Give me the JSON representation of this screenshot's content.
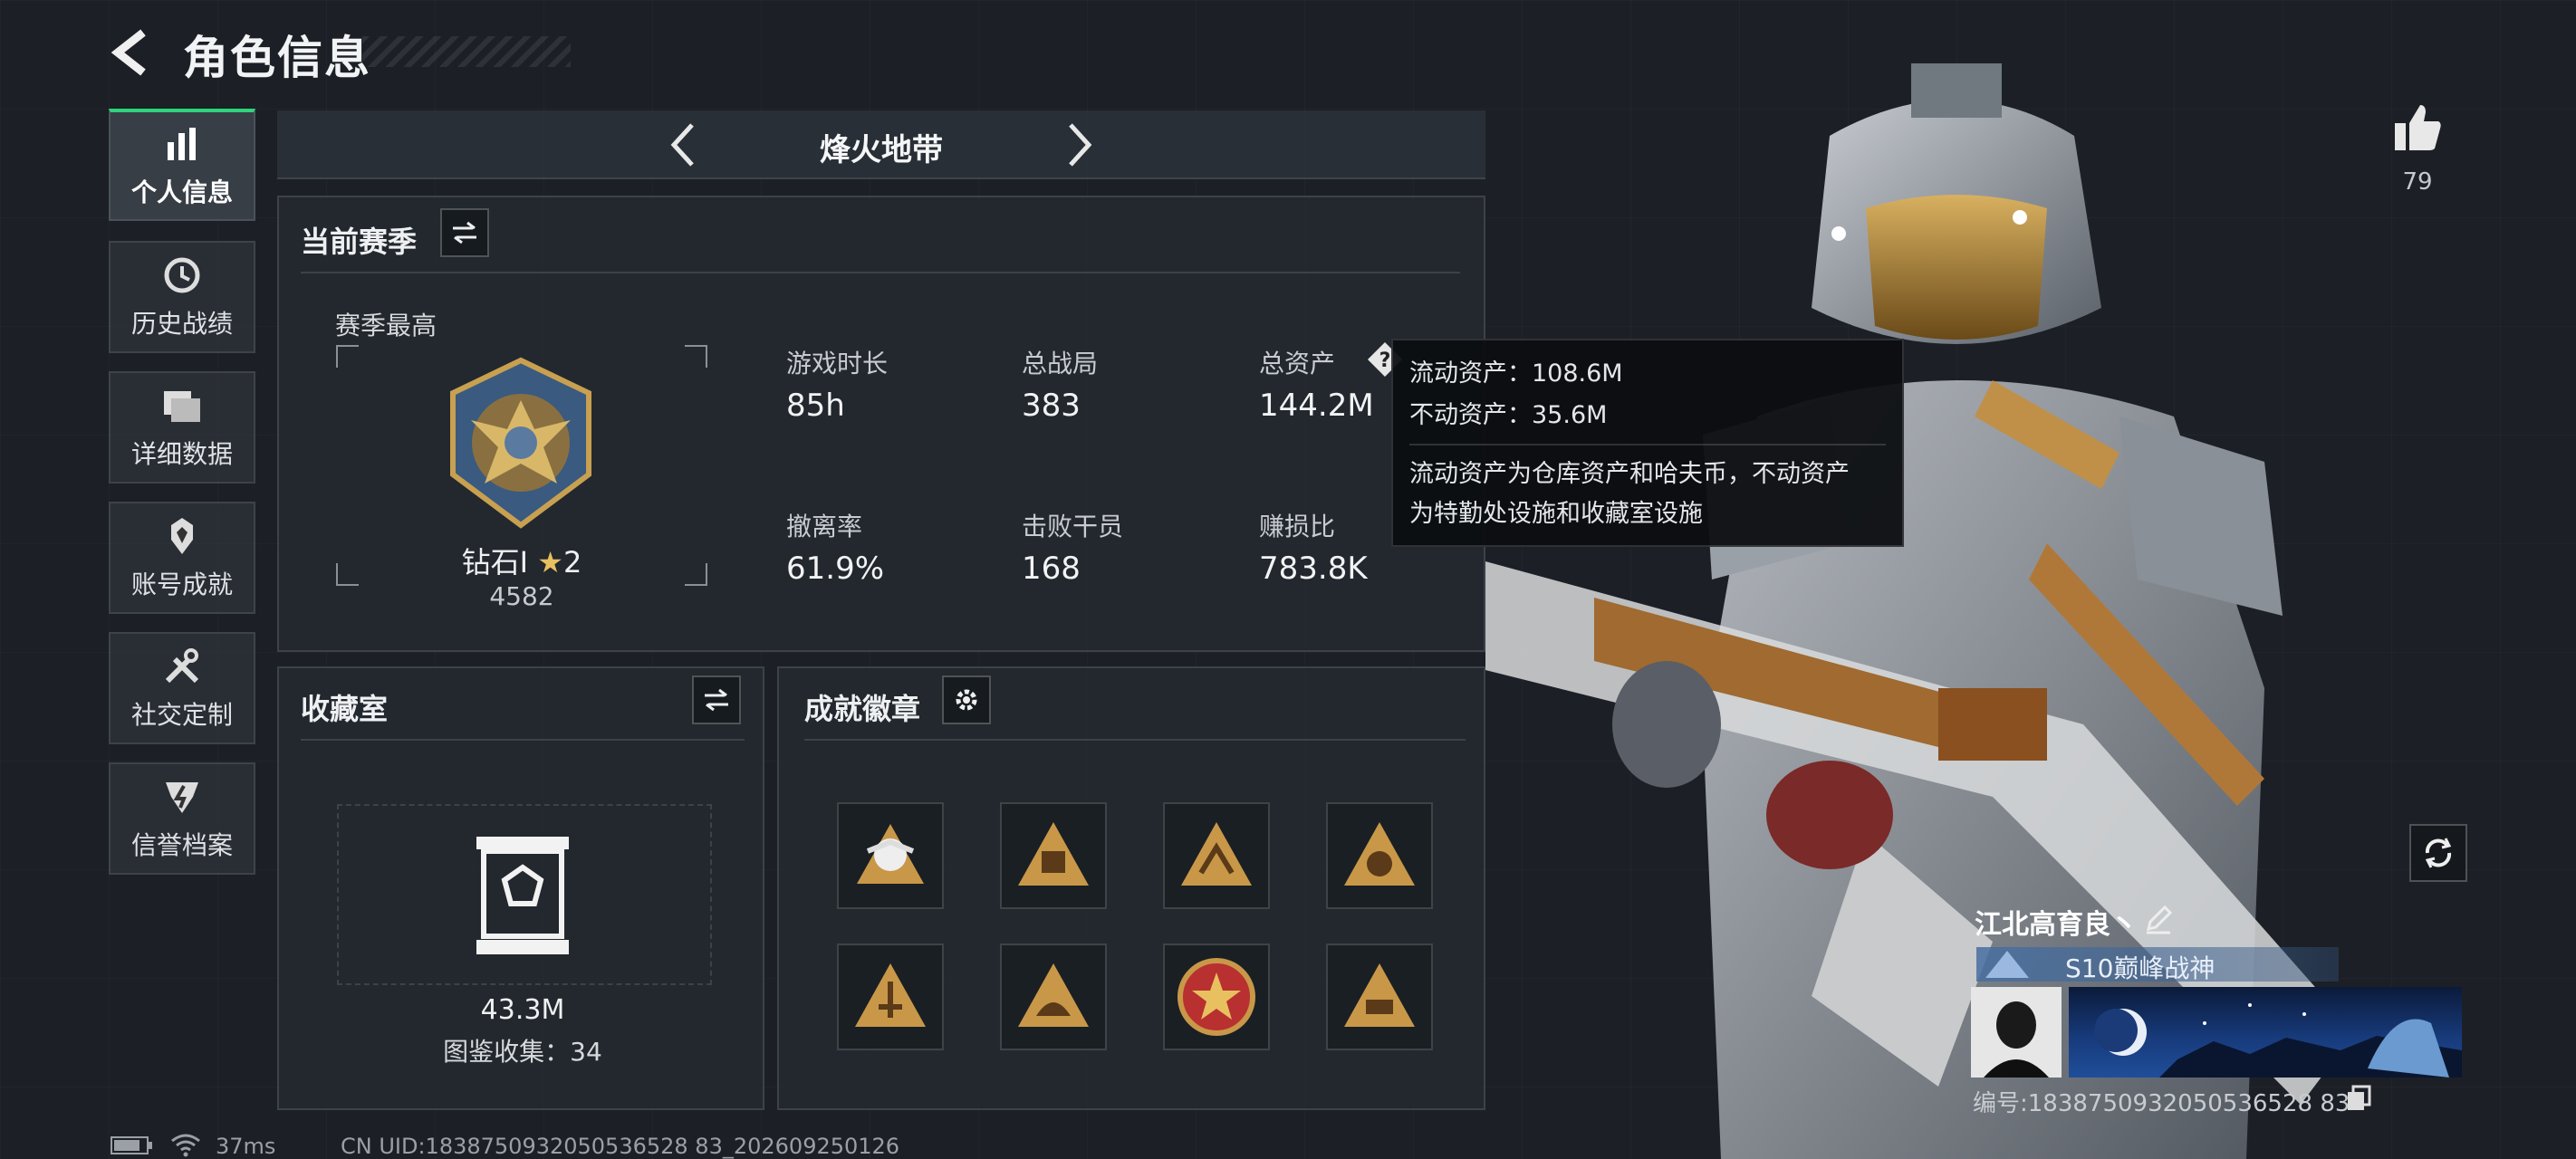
{
  "header": {
    "title": "角色信息"
  },
  "sidebar": {
    "items": [
      {
        "label": "个人信息",
        "icon": "bar-chart-icon",
        "active": true
      },
      {
        "label": "历史战绩",
        "icon": "history-clock-icon",
        "active": false
      },
      {
        "label": "详细数据",
        "icon": "folder-icon",
        "active": false
      },
      {
        "label": "账号成就",
        "icon": "achievement-icon",
        "active": false
      },
      {
        "label": "社交定制",
        "icon": "tools-icon",
        "active": false
      },
      {
        "label": "信誉档案",
        "icon": "reputation-shield-icon",
        "active": false
      }
    ]
  },
  "mode": {
    "title": "烽火地带"
  },
  "season": {
    "title": "当前赛季",
    "best_label": "赛季最高",
    "rank_name": "钻石I",
    "rank_stars": "2",
    "rank_score": "4582",
    "stats": [
      {
        "label": "游戏时长",
        "value": "85h"
      },
      {
        "label": "总战局",
        "value": "383"
      },
      {
        "label": "总资产",
        "value": "144.2M"
      },
      {
        "label": "撤离率",
        "value": "61.9%"
      },
      {
        "label": "击败干员",
        "value": "168"
      },
      {
        "label": "赚损比",
        "value": "783.8K"
      }
    ]
  },
  "tooltip": {
    "line1": "流动资产：108.6M",
    "line2": "不动资产：35.6M",
    "desc1": "流动资产为仓库资产和哈夫币，不动资产",
    "desc2": "为特勤处设施和收藏室设施"
  },
  "collection": {
    "title": "收藏室",
    "value": "43.3M",
    "catalog": "图鉴收集：34"
  },
  "badges": {
    "title": "成就徽章"
  },
  "likes": {
    "count": "79"
  },
  "player": {
    "name": "江北高育良丶",
    "title": "S10巅峰战神",
    "uid": "编号:1838750932050536528 83"
  },
  "status_bar": {
    "ping": "37ms",
    "uid": "CN UID:1838750932050536528 83_202609250126"
  },
  "colors": {
    "accent": "#2fd47c",
    "gold": "#c8a050",
    "background": "#1c2026"
  }
}
